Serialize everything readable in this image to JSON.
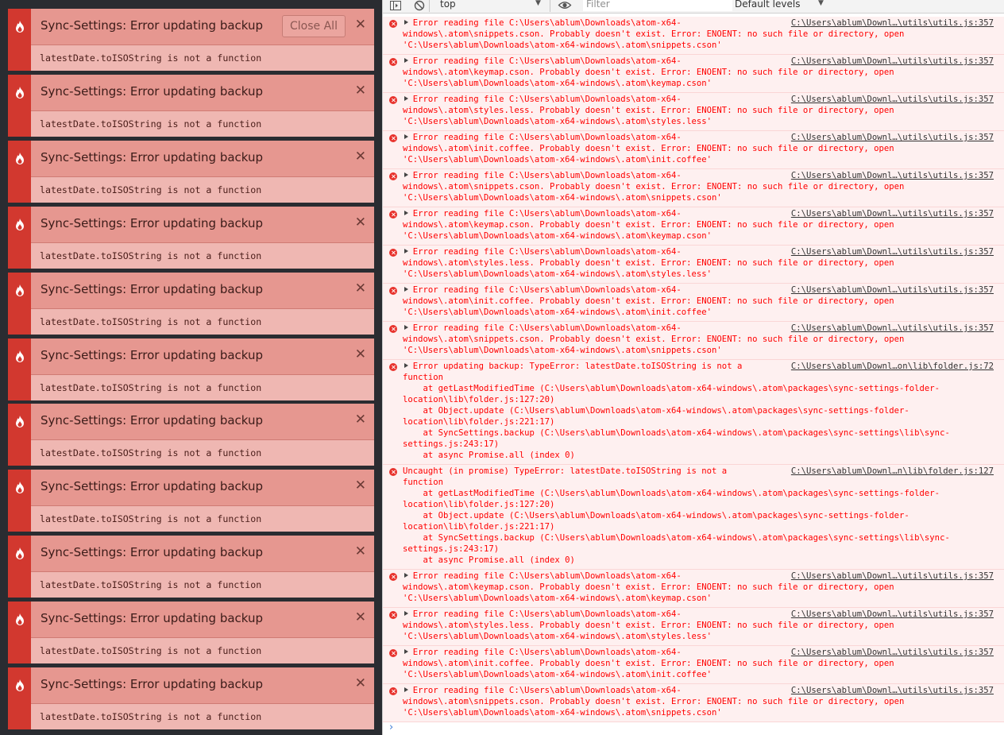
{
  "notifications": {
    "close_all_label": "Close All",
    "icon": "flame-icon",
    "colors": {
      "accent": "#d2382f",
      "header": "#e69790",
      "body": "#efb7b2"
    },
    "items": [
      {
        "title": "Sync-Settings: Error updating backup",
        "message": "latestDate.toISOString is not a function"
      },
      {
        "title": "Sync-Settings: Error updating backup",
        "message": "latestDate.toISOString is not a function"
      },
      {
        "title": "Sync-Settings: Error updating backup",
        "message": "latestDate.toISOString is not a function"
      },
      {
        "title": "Sync-Settings: Error updating backup",
        "message": "latestDate.toISOString is not a function"
      },
      {
        "title": "Sync-Settings: Error updating backup",
        "message": "latestDate.toISOString is not a function"
      },
      {
        "title": "Sync-Settings: Error updating backup",
        "message": "latestDate.toISOString is not a function"
      },
      {
        "title": "Sync-Settings: Error updating backup",
        "message": "latestDate.toISOString is not a function"
      },
      {
        "title": "Sync-Settings: Error updating backup",
        "message": "latestDate.toISOString is not a function"
      },
      {
        "title": "Sync-Settings: Error updating backup",
        "message": "latestDate.toISOString is not a function"
      },
      {
        "title": "Sync-Settings: Error updating backup",
        "message": "latestDate.toISOString is not a function"
      },
      {
        "title": "Sync-Settings: Error updating backup",
        "message": "latestDate.toISOString is not a function"
      }
    ]
  },
  "console_toolbar": {
    "context": "top",
    "filter_placeholder": "Filter",
    "levels": "Default levels"
  },
  "console_entries": [
    {
      "expandable": true,
      "text": "Error reading file C:\\Users\\ablum\\Downloads\\atom-x64-\nwindows\\.atom\\snippets.cson. Probably doesn't exist. Error: ENOENT: no such file or directory, open\n'C:\\Users\\ablum\\Downloads\\atom-x64-windows\\.atom\\snippets.cson'",
      "source": "C:\\Users\\ablum\\Downl…\\utils\\utils.js:357"
    },
    {
      "expandable": true,
      "text": "Error reading file C:\\Users\\ablum\\Downloads\\atom-x64-\nwindows\\.atom\\keymap.cson. Probably doesn't exist. Error: ENOENT: no such file or directory, open\n'C:\\Users\\ablum\\Downloads\\atom-x64-windows\\.atom\\keymap.cson'",
      "source": "C:\\Users\\ablum\\Downl…\\utils\\utils.js:357"
    },
    {
      "expandable": true,
      "text": "Error reading file C:\\Users\\ablum\\Downloads\\atom-x64-\nwindows\\.atom\\styles.less. Probably doesn't exist. Error: ENOENT: no such file or directory, open\n'C:\\Users\\ablum\\Downloads\\atom-x64-windows\\.atom\\styles.less'",
      "source": "C:\\Users\\ablum\\Downl…\\utils\\utils.js:357"
    },
    {
      "expandable": true,
      "text": "Error reading file C:\\Users\\ablum\\Downloads\\atom-x64-\nwindows\\.atom\\init.coffee. Probably doesn't exist. Error: ENOENT: no such file or directory, open\n'C:\\Users\\ablum\\Downloads\\atom-x64-windows\\.atom\\init.coffee'",
      "source": "C:\\Users\\ablum\\Downl…\\utils\\utils.js:357"
    },
    {
      "expandable": true,
      "text": "Error reading file C:\\Users\\ablum\\Downloads\\atom-x64-\nwindows\\.atom\\snippets.cson. Probably doesn't exist. Error: ENOENT: no such file or directory, open\n'C:\\Users\\ablum\\Downloads\\atom-x64-windows\\.atom\\snippets.cson'",
      "source": "C:\\Users\\ablum\\Downl…\\utils\\utils.js:357"
    },
    {
      "expandable": true,
      "text": "Error reading file C:\\Users\\ablum\\Downloads\\atom-x64-\nwindows\\.atom\\keymap.cson. Probably doesn't exist. Error: ENOENT: no such file or directory, open\n'C:\\Users\\ablum\\Downloads\\atom-x64-windows\\.atom\\keymap.cson'",
      "source": "C:\\Users\\ablum\\Downl…\\utils\\utils.js:357"
    },
    {
      "expandable": true,
      "text": "Error reading file C:\\Users\\ablum\\Downloads\\atom-x64-\nwindows\\.atom\\styles.less. Probably doesn't exist. Error: ENOENT: no such file or directory, open\n'C:\\Users\\ablum\\Downloads\\atom-x64-windows\\.atom\\styles.less'",
      "source": "C:\\Users\\ablum\\Downl…\\utils\\utils.js:357"
    },
    {
      "expandable": true,
      "text": "Error reading file C:\\Users\\ablum\\Downloads\\atom-x64-\nwindows\\.atom\\init.coffee. Probably doesn't exist. Error: ENOENT: no such file or directory, open\n'C:\\Users\\ablum\\Downloads\\atom-x64-windows\\.atom\\init.coffee'",
      "source": "C:\\Users\\ablum\\Downl…\\utils\\utils.js:357"
    },
    {
      "expandable": true,
      "text": "Error reading file C:\\Users\\ablum\\Downloads\\atom-x64-\nwindows\\.atom\\snippets.cson. Probably doesn't exist. Error: ENOENT: no such file or directory, open\n'C:\\Users\\ablum\\Downloads\\atom-x64-windows\\.atom\\snippets.cson'",
      "source": "C:\\Users\\ablum\\Downl…\\utils\\utils.js:357"
    },
    {
      "expandable": true,
      "text": "Error updating backup: TypeError: latestDate.toISOString is not a\nfunction\n    at getLastModifiedTime (C:\\Users\\ablum\\Downloads\\atom-x64-windows\\.atom\\packages\\sync-settings-folder-\nlocation\\lib\\folder.js:127:20)\n    at Object.update (C:\\Users\\ablum\\Downloads\\atom-x64-windows\\.atom\\packages\\sync-settings-folder-\nlocation\\lib\\folder.js:221:17)\n    at SyncSettings.backup (C:\\Users\\ablum\\Downloads\\atom-x64-windows\\.atom\\packages\\sync-settings\\lib\\sync-\nsettings.js:243:17)\n    at async Promise.all (index 0)",
      "source": "C:\\Users\\ablum\\Downl…on\\lib\\folder.js:72"
    },
    {
      "expandable": false,
      "text": "Uncaught (in promise) TypeError: latestDate.toISOString is not a\nfunction\n    at getLastModifiedTime (C:\\Users\\ablum\\Downloads\\atom-x64-windows\\.atom\\packages\\sync-settings-folder-\nlocation\\lib\\folder.js:127:20)\n    at Object.update (C:\\Users\\ablum\\Downloads\\atom-x64-windows\\.atom\\packages\\sync-settings-folder-\nlocation\\lib\\folder.js:221:17)\n    at SyncSettings.backup (C:\\Users\\ablum\\Downloads\\atom-x64-windows\\.atom\\packages\\sync-settings\\lib\\sync-\nsettings.js:243:17)\n    at async Promise.all (index 0)",
      "source": "C:\\Users\\ablum\\Downl…n\\lib\\folder.js:127"
    },
    {
      "expandable": true,
      "text": "Error reading file C:\\Users\\ablum\\Downloads\\atom-x64-\nwindows\\.atom\\keymap.cson. Probably doesn't exist. Error: ENOENT: no such file or directory, open\n'C:\\Users\\ablum\\Downloads\\atom-x64-windows\\.atom\\keymap.cson'",
      "source": "C:\\Users\\ablum\\Downl…\\utils\\utils.js:357"
    },
    {
      "expandable": true,
      "text": "Error reading file C:\\Users\\ablum\\Downloads\\atom-x64-\nwindows\\.atom\\styles.less. Probably doesn't exist. Error: ENOENT: no such file or directory, open\n'C:\\Users\\ablum\\Downloads\\atom-x64-windows\\.atom\\styles.less'",
      "source": "C:\\Users\\ablum\\Downl…\\utils\\utils.js:357"
    },
    {
      "expandable": true,
      "text": "Error reading file C:\\Users\\ablum\\Downloads\\atom-x64-\nwindows\\.atom\\init.coffee. Probably doesn't exist. Error: ENOENT: no such file or directory, open\n'C:\\Users\\ablum\\Downloads\\atom-x64-windows\\.atom\\init.coffee'",
      "source": "C:\\Users\\ablum\\Downl…\\utils\\utils.js:357"
    },
    {
      "expandable": true,
      "text": "Error reading file C:\\Users\\ablum\\Downloads\\atom-x64-\nwindows\\.atom\\snippets.cson. Probably doesn't exist. Error: ENOENT: no such file or directory, open\n'C:\\Users\\ablum\\Downloads\\atom-x64-windows\\.atom\\snippets.cson'",
      "source": "C:\\Users\\ablum\\Downl…\\utils\\utils.js:357"
    }
  ],
  "console_prompt": "›"
}
